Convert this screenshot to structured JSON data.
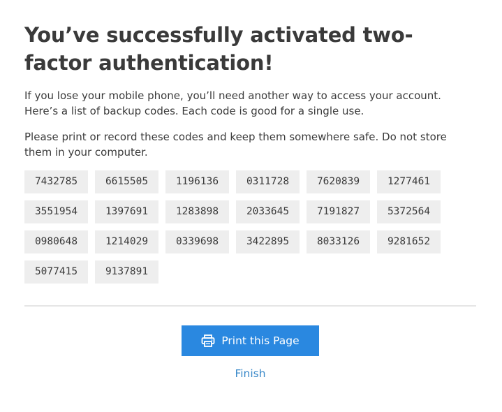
{
  "page": {
    "title": "You’ve successfully activated two-factor authentication!",
    "paragraph1": "If you lose your mobile phone, you’ll need another way to access your account. Here’s a list of backup codes. Each code is good for a single use.",
    "paragraph2": "Please print or record these codes and keep them somewhere safe. Do not store them in your computer."
  },
  "backup_codes": [
    "7432785",
    "6615505",
    "1196136",
    "0311728",
    "7620839",
    "1277461",
    "3551954",
    "1397691",
    "1283898",
    "2033645",
    "7191827",
    "5372564",
    "0980648",
    "1214029",
    "0339698",
    "3422895",
    "8033126",
    "9281652",
    "5077415",
    "9137891"
  ],
  "actions": {
    "print_label": "Print this Page",
    "print_icon": "printer-icon",
    "finish_label": "Finish"
  },
  "colors": {
    "primary_button": "#2a88e0",
    "link": "#3a89c9",
    "code_background": "#eeeeee"
  }
}
